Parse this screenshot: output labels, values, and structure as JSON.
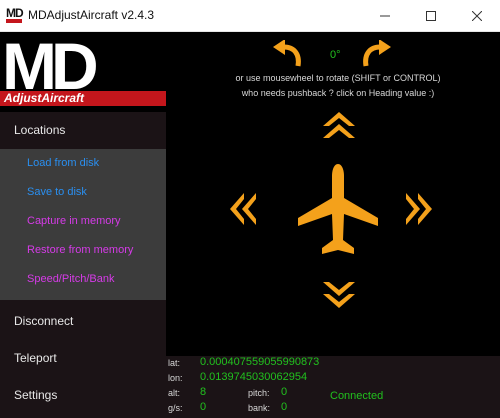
{
  "window": {
    "title": "MDAdjustAircraft v2.4.3",
    "app_icon_text": "MD"
  },
  "logo": {
    "big_text": "MD",
    "sub_text": "AdjustAircraft"
  },
  "menu": {
    "locations": "Locations",
    "load": "Load from disk",
    "save": "Save to disk",
    "capture": "Capture in memory",
    "restore": "Restore from memory",
    "speed": "Speed/Pitch/Bank",
    "disconnect": "Disconnect",
    "teleport": "Teleport",
    "settings": "Settings"
  },
  "controls": {
    "heading_value": "0°",
    "hint_line1": "or use mousewheel to rotate (SHIFT or CONTROL)",
    "hint_line2": "who needs pushback ? click on Heading value :)"
  },
  "status": {
    "lat_label": "lat:",
    "lat_value": "0.000407559055990873",
    "lon_label": "lon:",
    "lon_value": "0.0139745030062954",
    "alt_label": "alt:",
    "alt_value": "8",
    "gs_label": "g/s:",
    "gs_value": "0",
    "pitch_label": "pitch:",
    "pitch_value": "0",
    "bank_label": "bank:",
    "bank_value": "0",
    "connection": "Connected"
  },
  "colors": {
    "accent_orange": "#f4a11b",
    "status_green": "#21c01e",
    "menu_blue": "#2a8ff0",
    "menu_magenta": "#d63be8",
    "logo_red": "#c4161c"
  }
}
